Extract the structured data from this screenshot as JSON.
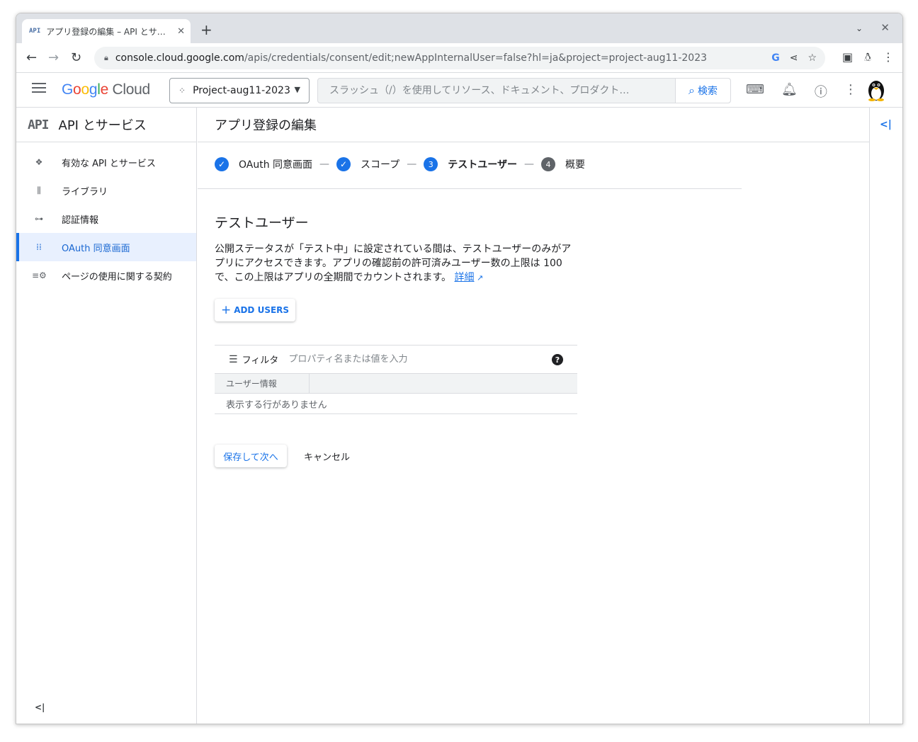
{
  "browser": {
    "tab_favicon": "API",
    "tab_title": "アプリ登録の編集 – API とサ…",
    "new_tab": "+",
    "url_host": "console.cloud.google.com",
    "url_path": "/apis/credentials/consent/edit;newAppInternalUser=false?hl=ja&project=project-aug11-2023"
  },
  "header": {
    "logo_google": "Google",
    "logo_cloud": "Cloud",
    "project_name": "Project-aug11-2023",
    "search_placeholder": "スラッシュ（/）を使用してリソース、ドキュメント、プロダクト…",
    "search_button": "検索"
  },
  "sidebar": {
    "badge": "API",
    "title": "API とサービス",
    "items": [
      {
        "label": "有効な API とサービス",
        "icon": "api-diamond-icon"
      },
      {
        "label": "ライブラリ",
        "icon": "library-icon"
      },
      {
        "label": "認証情報",
        "icon": "key-icon"
      },
      {
        "label": "OAuth 同意画面",
        "icon": "consent-dots-icon",
        "active": true
      },
      {
        "label": "ページの使用に関する契約",
        "icon": "settings-list-icon"
      }
    ]
  },
  "main": {
    "page_title": "アプリ登録の編集",
    "steps": [
      {
        "label": "OAuth 同意画面",
        "state": "done"
      },
      {
        "label": "スコープ",
        "state": "done"
      },
      {
        "number": "3",
        "label": "テストユーザー",
        "state": "current"
      },
      {
        "number": "4",
        "label": "概要",
        "state": "pending"
      }
    ],
    "step_separator": "—",
    "section_title": "テストユーザー",
    "description": "公開ステータスが「テスト中」に設定されている間は、テストユーザーのみがアプリにアクセスできます。アプリの確認前の許可済みユーザー数の上限は 100 で、この上限はアプリの全期間でカウントされます。",
    "learn_more": "詳細",
    "add_users": "ADD USERS",
    "filter_label": "フィルタ",
    "filter_placeholder": "プロパティ名または値を入力",
    "column_header": "ユーザー情報",
    "empty_message": "表示する行がありません",
    "save_button": "保存して次へ",
    "cancel_button": "キャンセル"
  },
  "colors": {
    "accent": "#1a73e8",
    "active_bg": "#e8f0fe",
    "step_pending": "#5f6368"
  }
}
